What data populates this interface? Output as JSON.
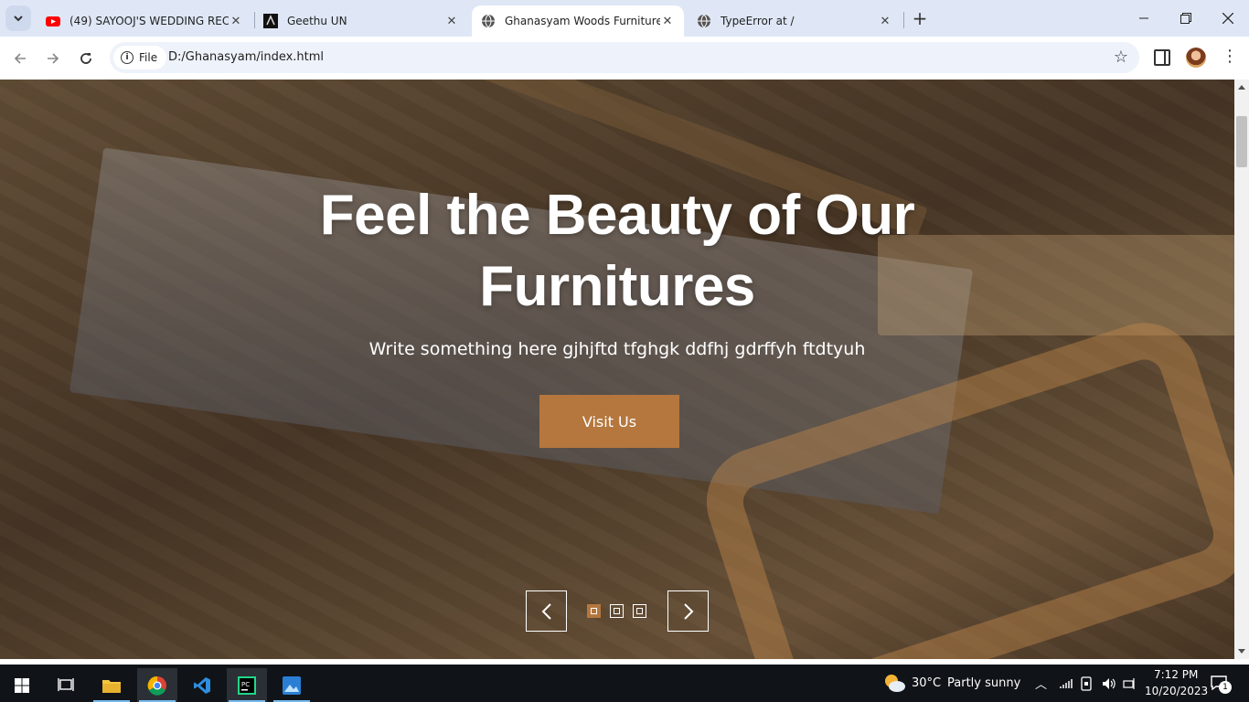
{
  "browser": {
    "tabs": [
      {
        "title": "(49) SAYOOJ'S WEDDING RECE",
        "icon": "youtube-icon",
        "active": false
      },
      {
        "title": "Geethu UN",
        "icon": "site-icon",
        "active": false
      },
      {
        "title": "Ghanasyam Woods Furniture &",
        "icon": "globe-icon",
        "active": true
      },
      {
        "title": "TypeError at /",
        "icon": "globe-icon",
        "active": false
      }
    ],
    "chip_label": "File",
    "url": "D:/Ghanasyam/index.html"
  },
  "hero": {
    "title_line1": "Feel the Beauty of Our",
    "title_line2": "Furnitures",
    "subtitle": "Write something here gjhjftd tfghgk ddfhj gdrffyh ftdtyuh",
    "cta_label": "Visit Us",
    "accent_color": "#b5773e",
    "slides": 3,
    "active_slide": 1
  },
  "taskbar": {
    "weather": {
      "temp": "30°C",
      "desc": "Partly sunny"
    },
    "time": "7:12 PM",
    "date": "10/20/2023",
    "notification_count": "1"
  }
}
